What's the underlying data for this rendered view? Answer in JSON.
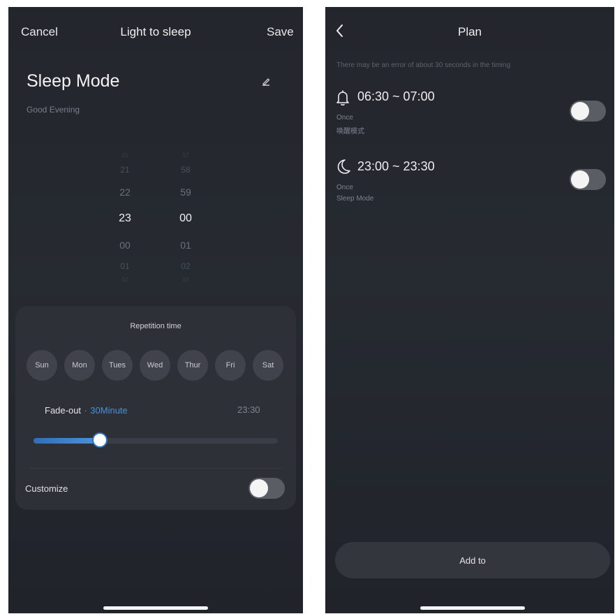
{
  "left": {
    "cancel_label": "Cancel",
    "title": "Light to sleep",
    "save_label": "Save",
    "mode_title": "Sleep Mode",
    "mode_subtitle": "Good Evening",
    "edit_icon": "pencil-icon",
    "picker": {
      "hours": [
        "20",
        "21",
        "22",
        "23",
        "00",
        "01",
        "02"
      ],
      "minutes": [
        "57",
        "58",
        "59",
        "00",
        "01",
        "02",
        "03"
      ],
      "selected_hour": "23",
      "selected_minute": "00"
    },
    "repetition": {
      "title": "Repetition time",
      "days": [
        "Sun",
        "Mon",
        "Tues",
        "Wed",
        "Thur",
        "Fri",
        "Sat"
      ]
    },
    "fade": {
      "label": "Fade-out",
      "separator": "·",
      "value": "30Minute",
      "end_time": "23:30",
      "slider_fraction": 0.27
    },
    "customize": {
      "label": "Customize",
      "enabled": false
    }
  },
  "right": {
    "back_icon": "chevron-left-icon",
    "title": "Plan",
    "notice": "There may be an error of about 30 seconds in the timing",
    "plans": [
      {
        "icon": "bell-icon",
        "time_range": "06:30 ~ 07:00",
        "repeat": "Once",
        "mode": "唤醒模式",
        "enabled": false
      },
      {
        "icon": "moon-icon",
        "time_range": "23:00 ~ 23:30",
        "repeat": "Once",
        "mode": "Sleep Mode",
        "enabled": false
      }
    ],
    "add_label": "Add to"
  },
  "colors": {
    "accent": "#4a90d9",
    "background": "#23262c",
    "card": "#2d3037"
  }
}
